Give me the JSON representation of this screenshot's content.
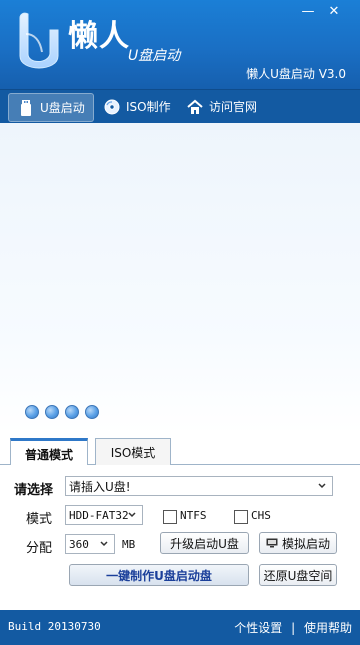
{
  "header": {
    "title": "懒人",
    "subtitle": "U盘启动",
    "version": "懒人U盘启动 V3.0",
    "minimize": "—",
    "close": "✕"
  },
  "nav": {
    "items": [
      {
        "label": "U盘启动"
      },
      {
        "label": "ISO制作"
      },
      {
        "label": "访问官网"
      }
    ]
  },
  "tabs": {
    "items": [
      {
        "label": "普通模式"
      },
      {
        "label": "ISO模式"
      }
    ]
  },
  "form": {
    "device_label": "请选择",
    "device_value": "请插入U盘!",
    "mode_label": "模式",
    "mode_value": "HDD-FAT32",
    "ntfs_label": "NTFS",
    "chs_label": "CHS",
    "partition_label": "分配",
    "partition_value": "360",
    "partition_unit": "MB",
    "upgrade_button": "升级启动U盘",
    "simulate_button": "模拟启动",
    "make_button": "一键制作U盘启动盘",
    "restore_button": "还原U盘空间"
  },
  "status": {
    "build": "Build 20130730",
    "settings": "个性设置",
    "separator": "|",
    "help": "使用帮助"
  },
  "colors": {
    "header_blue": "#1a6fc4",
    "nav_blue": "#135aa2",
    "primary_text": "#1b3f9a"
  }
}
